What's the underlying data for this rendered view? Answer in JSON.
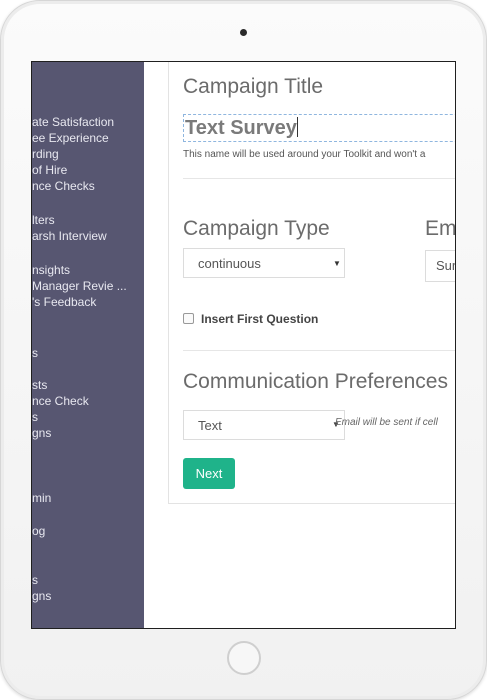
{
  "sidebar": {
    "items": [
      "ate Satisfaction",
      "ee Experience",
      "rding",
      " of Hire",
      "nce Checks",
      "lters",
      "arsh Interview",
      "nsights",
      "Manager Revie ...",
      "'s Feedback",
      "s",
      "sts",
      "nce Check",
      "s",
      "gns",
      "min",
      "og",
      "s",
      "gns"
    ]
  },
  "form": {
    "campaign_title_heading": "Campaign Title",
    "campaign_title_value": "Text Survey",
    "campaign_title_help": "This name will be used around your Toolkit and won't a",
    "campaign_type_heading": "Campaign Type",
    "campaign_type_value": "continuous",
    "email_heading": "Em",
    "email_select_value": "Sur",
    "insert_first_question_label": "Insert First Question",
    "communication_heading": "Communication Preferences",
    "communication_value": "Text",
    "communication_note": "Email will be sent if cell",
    "next_label": "Next"
  },
  "icons": {
    "dropdown": "caret-down-icon"
  },
  "colors": {
    "sidebar": "#575671",
    "accent": "#1fb38a"
  }
}
